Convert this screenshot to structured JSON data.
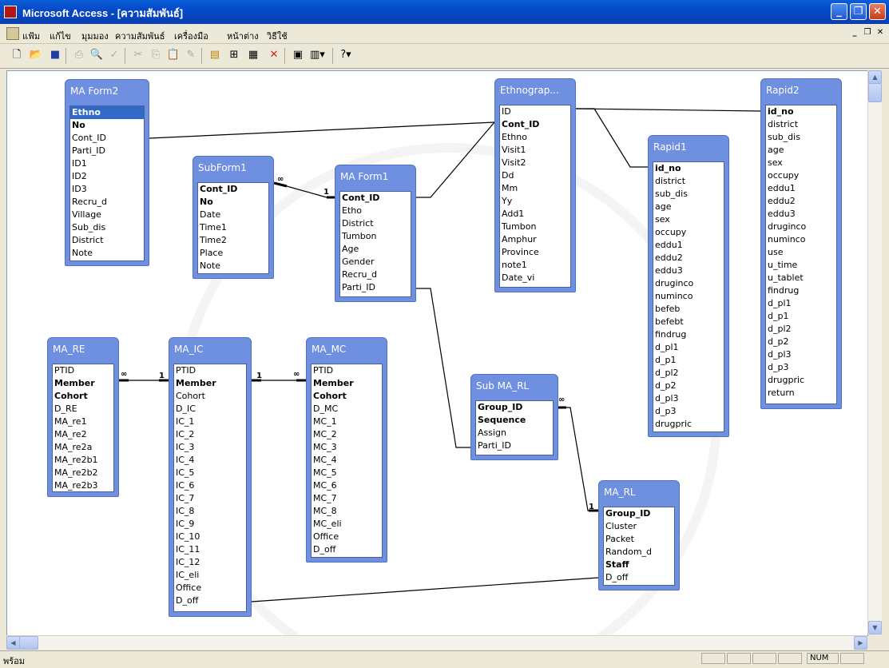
{
  "window": {
    "title": "Microsoft Access - [ความสัมพันธ์]"
  },
  "menu": {
    "items": [
      "แฟ้ม",
      "แก้ไข",
      "มุมมอง",
      "ความสัมพันธ์",
      "เครื่องมือ",
      "หน้าต่าง",
      "วิธีใช้"
    ]
  },
  "toolbar": {
    "icons": [
      "new-icon",
      "open-icon",
      "save-icon",
      "print-icon",
      "print-preview-icon",
      "spelling-icon",
      "cut-icon",
      "copy-icon",
      "paste-icon",
      "format-painter-icon",
      "show-table-icon",
      "show-direct-icon",
      "show-all-icon",
      "delete-icon",
      "database-window-icon",
      "new-object-icon",
      "help-icon"
    ]
  },
  "tables": {
    "ma_form2": {
      "title": "MA Form2",
      "fields": [
        "Ethno",
        "No",
        "Cont_ID",
        "Parti_ID",
        "ID1",
        "ID2",
        "ID3",
        "Recru_d",
        "Village",
        "Sub_dis",
        "District",
        "Note"
      ]
    },
    "subform1": {
      "title": "SubForm1",
      "fields": [
        "Cont_ID",
        "No",
        "Date",
        "Time1",
        "Time2",
        "Place",
        "Note"
      ]
    },
    "ma_form1": {
      "title": "MA Form1",
      "fields": [
        "Cont_ID",
        "Etho",
        "District",
        "Tumbon",
        "Age",
        "Gender",
        "Recru_d",
        "Parti_ID"
      ]
    },
    "ethnograp": {
      "title": "Ethnograp...",
      "fields": [
        "ID",
        "Cont_ID",
        "Ethno",
        "Visit1",
        "Visit2",
        "Dd",
        "Mm",
        "Yy",
        "Add1",
        "Tumbon",
        "Amphur",
        "Province",
        "note1",
        "Date_vi"
      ]
    },
    "rapid1": {
      "title": "Rapid1",
      "fields": [
        "id_no",
        "district",
        "sub_dis",
        "age",
        "sex",
        "occupy",
        "eddu1",
        "eddu2",
        "eddu3",
        "druginco",
        "numinco",
        "befeb",
        "befebt",
        "findrug",
        "d_pl1",
        "d_p1",
        "d_pl2",
        "d_p2",
        "d_pl3",
        "d_p3",
        "drugpric"
      ]
    },
    "rapid2": {
      "title": "Rapid2",
      "fields": [
        "id_no",
        "district",
        "sub_dis",
        "age",
        "sex",
        "occupy",
        "eddu1",
        "eddu2",
        "eddu3",
        "druginco",
        "numinco",
        "use",
        "u_time",
        "u_tablet",
        "findrug",
        "d_pl1",
        "d_p1",
        "d_pl2",
        "d_p2",
        "d_pl3",
        "d_p3",
        "drugpric",
        "return"
      ]
    },
    "ma_re": {
      "title": "MA_RE",
      "fields": [
        "PTID",
        "Member",
        "Cohort",
        "D_RE",
        "MA_re1",
        "MA_re2",
        "MA_re2a",
        "MA_re2b1",
        "MA_re2b2",
        "MA_re2b3"
      ]
    },
    "ma_ic": {
      "title": "MA_IC",
      "fields": [
        "PTID",
        "Member",
        "Cohort",
        "D_IC",
        "IC_1",
        "IC_2",
        "IC_3",
        "IC_4",
        "IC_5",
        "IC_6",
        "IC_7",
        "IC_8",
        "IC_9",
        "IC_10",
        "IC_11",
        "IC_12",
        "IC_eli",
        "Office",
        "D_off"
      ]
    },
    "ma_mc": {
      "title": "MA_MC",
      "fields": [
        "PTID",
        "Member",
        "Cohort",
        "D_MC",
        "MC_1",
        "MC_2",
        "MC_3",
        "MC_4",
        "MC_5",
        "MC_6",
        "MC_7",
        "MC_8",
        "MC_eli",
        "Office",
        "D_off"
      ]
    },
    "sub_ma_rl": {
      "title": "Sub MA_RL",
      "fields": [
        "Group_ID",
        "Sequence",
        "Assign",
        "Parti_ID"
      ]
    },
    "ma_rl": {
      "title": "MA_RL",
      "fields": [
        "Group_ID",
        "Cluster",
        "Packet",
        "Random_d",
        "Staff",
        "D_off"
      ]
    }
  },
  "relationship_labels": {
    "one": "1",
    "many": "∞"
  },
  "status": {
    "text": "พร้อม",
    "num": "NUM"
  }
}
